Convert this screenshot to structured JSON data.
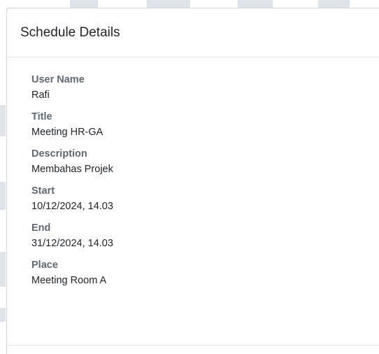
{
  "modal": {
    "title": "Schedule Details",
    "fields": [
      {
        "label": "User Name",
        "value": "Rafi"
      },
      {
        "label": "Title",
        "value": "Meeting HR-GA"
      },
      {
        "label": "Description",
        "value": "Membahas Projek"
      },
      {
        "label": "Start",
        "value": "10/12/2024, 14.03"
      },
      {
        "label": "End",
        "value": "31/12/2024, 14.03"
      },
      {
        "label": "Place",
        "value": "Meeting Room A"
      }
    ]
  },
  "colors": {
    "label": "#5f6873",
    "text": "#212529",
    "divider": "#e3e6ea",
    "watermark": "#dfe4ea"
  }
}
